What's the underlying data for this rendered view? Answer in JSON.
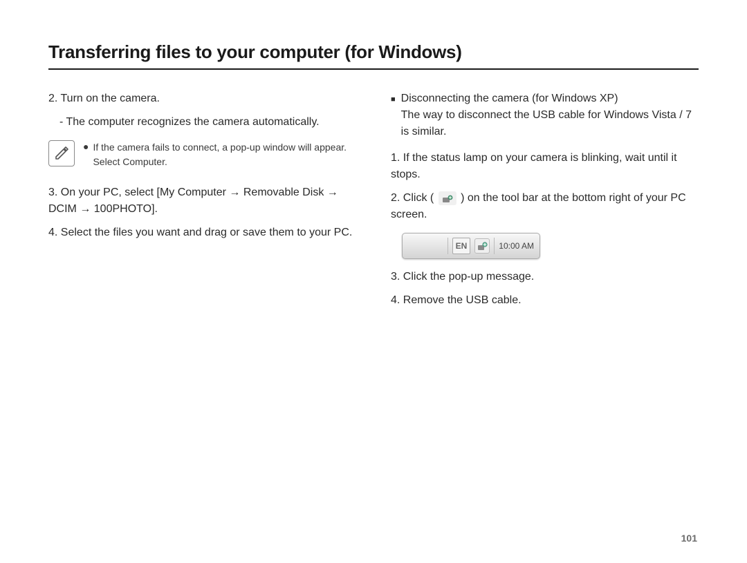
{
  "title": "Transferring files to your computer (for Windows)",
  "left": {
    "step2": "2. Turn on the camera.",
    "step2_sub": "- The computer recognizes the camera automatically.",
    "note_line1": "If the camera fails to connect, a pop-up window will appear.",
    "note_line2": "Select Computer.",
    "step3": "3. On your PC, select [My Computer → Removable Disk → DCIM → 100PHOTO].",
    "step4": "4. Select the files you want and drag or save them to your PC."
  },
  "right": {
    "subheading": "Disconnecting the camera (for Windows XP)",
    "sub_desc": "The way to disconnect the USB cable for Windows Vista / 7 is similar.",
    "step1": "1. If the status lamp on your camera is blinking, wait until it stops.",
    "step2_a": "2. Click ( ",
    "step2_b": " ) on the tool bar at the bottom right of your PC screen.",
    "taskbar": {
      "lang": "EN",
      "time": "10:00 AM"
    },
    "step3": "3. Click the pop-up message.",
    "step4": "4. Remove the USB cable."
  },
  "page_number": "101"
}
